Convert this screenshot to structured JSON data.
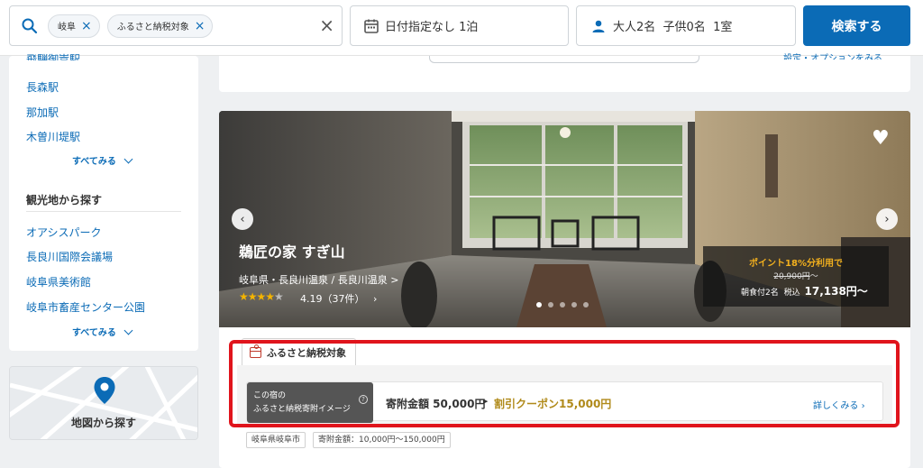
{
  "search": {
    "chips": [
      "岐阜",
      "ふるさと納税対象"
    ],
    "date_label": "日付指定なし 1泊",
    "guest_label": "大人2名  子供0名  1室",
    "search_button": "検索する"
  },
  "sidebar": {
    "stations_partial": "飛騨御嵩駅",
    "stations": [
      "長森駅",
      "那加駅",
      "木曽川堤駅"
    ],
    "see_all": "すべてみる",
    "sights_title": "観光地から探す",
    "sights": [
      "オアシスパーク",
      "長良川国際会議場",
      "岐阜県美術館",
      "岐阜市畜産センター公園"
    ],
    "map_label": "地図から探す"
  },
  "main": {
    "top_link_partial": "設定・オプションをみる"
  },
  "hotel": {
    "name": "鵜匠の家 すぎ山",
    "location": "岐阜県・長良川温泉 / 長良川温泉 >",
    "stars": 4.19,
    "rating_text": "4.19（37件）",
    "rating_chev": "›",
    "image_count": 5,
    "active_image": 1,
    "price": {
      "points": "ポイント18%分利用で",
      "original": "20,900円",
      "original_suffix": "〜",
      "plan": "朝食付2名",
      "tax": "税込",
      "final": "17,138円〜"
    },
    "furusato": {
      "tab_label": "ふるさと納税対象",
      "badge_line1": "この宿の",
      "badge_line2": "ふるさと納税寄附イメージ",
      "amount": "寄附金額 50,000円",
      "arrow": "▶",
      "coupon": "割引クーポン15,000円",
      "more": "詳しくみる  ›",
      "tag_city": "岐阜県岐阜市",
      "tag_range": "寄附金額：10,000円〜150,000円"
    }
  },
  "colors": {
    "accent": "#0b6bb6",
    "highlight_frame": "#e0141c",
    "points": "#f2b01e",
    "coupon": "#b08a1a"
  }
}
